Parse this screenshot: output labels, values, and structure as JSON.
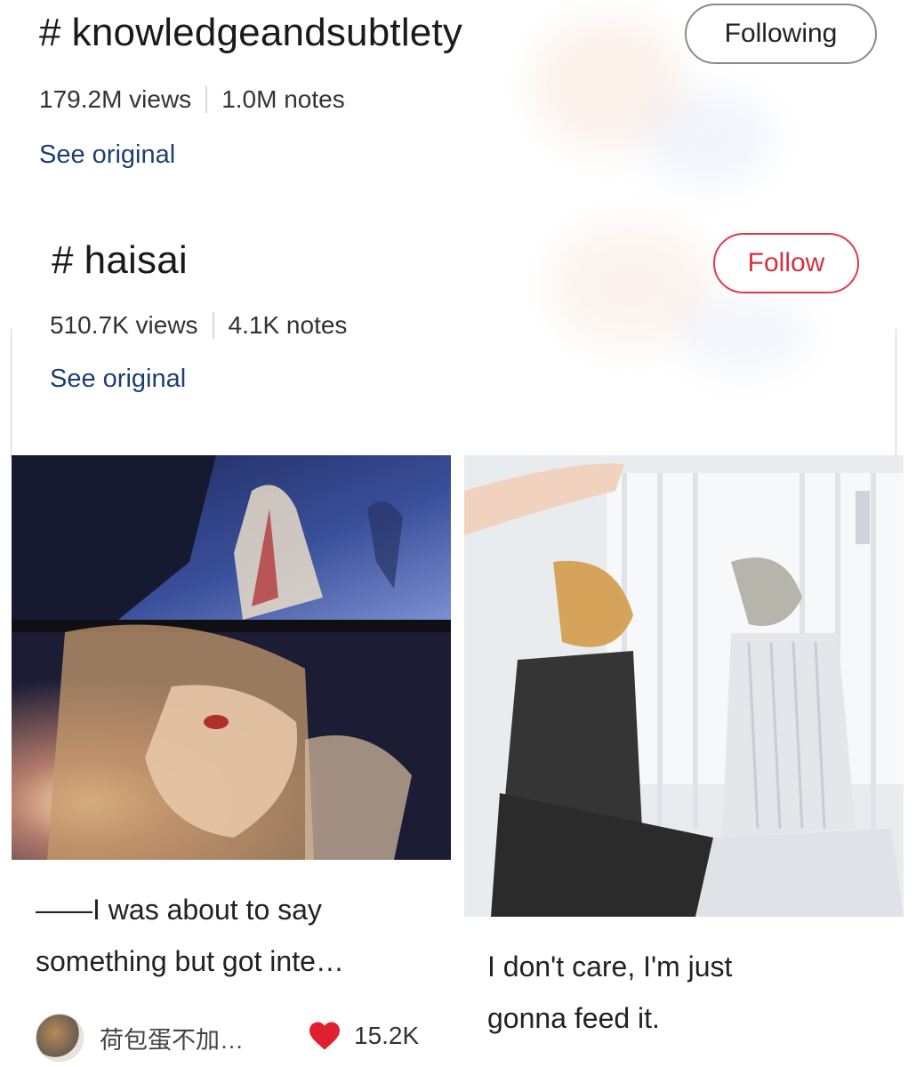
{
  "colors": {
    "link": "#1d3f73",
    "follow_red": "#d5303f",
    "heart_red": "#e0202e"
  },
  "tag1": {
    "hash": "#",
    "name": "knowledgeandsubtlety",
    "views": "179.2M views",
    "notes": "1.0M notes",
    "see_original": "See original",
    "button_label": "Following"
  },
  "tag2": {
    "hash": "#",
    "name": "haisai",
    "views": "510.7K views",
    "notes": "4.1K notes",
    "see_original": "See original",
    "button_label": "Follow"
  },
  "posts": [
    {
      "text_line1": "——I was about to say",
      "text_line2": "something but got inte…",
      "author": "荷包蛋不加…",
      "likes": "15.2K",
      "icon": "heart-icon"
    },
    {
      "text_line1": "I don't care, I'm just",
      "text_line2": "gonna feed it."
    }
  ]
}
